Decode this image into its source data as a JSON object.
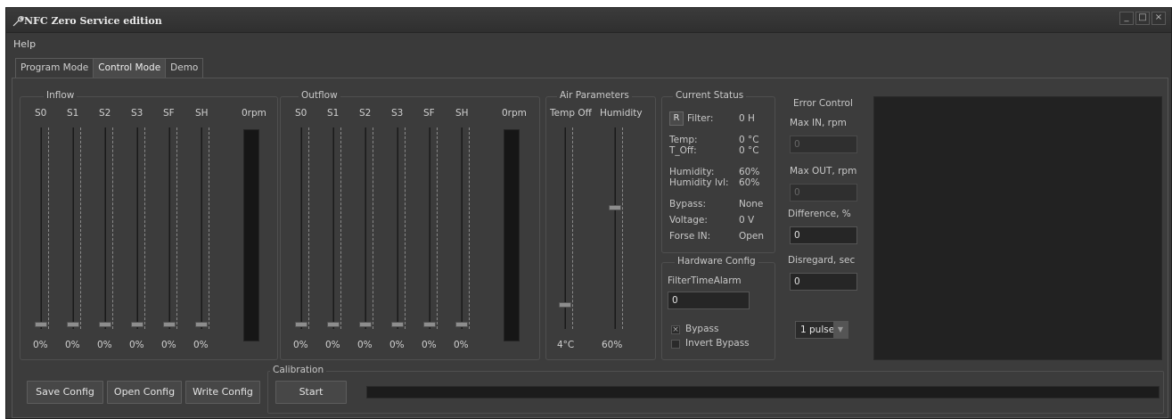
{
  "window": {
    "title": "NFC Zero Service edition",
    "controls": [
      "_",
      "□",
      "×"
    ]
  },
  "menu": {
    "help": "Help"
  },
  "tabs": [
    {
      "label": "Program Mode",
      "active": false
    },
    {
      "label": "Control Mode",
      "active": true
    },
    {
      "label": "Demo",
      "active": false
    }
  ],
  "inflow": {
    "title": "Inflow",
    "columns": [
      "S0",
      "S1",
      "S2",
      "S3",
      "SF",
      "SH"
    ],
    "values": [
      "0%",
      "0%",
      "0%",
      "0%",
      "0%",
      "0%"
    ],
    "slider_levels": [
      0,
      0,
      0,
      0,
      0,
      0
    ],
    "rpm_label": "0rpm"
  },
  "outflow": {
    "title": "Outflow",
    "columns": [
      "S0",
      "S1",
      "S2",
      "S3",
      "SF",
      "SH"
    ],
    "values": [
      "0%",
      "0%",
      "0%",
      "0%",
      "0%",
      "0%"
    ],
    "slider_levels": [
      0,
      0,
      0,
      0,
      0,
      0
    ],
    "rpm_label": "0rpm"
  },
  "air": {
    "title": "Air Parameters",
    "temp_label": "Temp Off",
    "humidity_label": "Humidity",
    "temp_value": "4°C",
    "humidity_value": "60%",
    "temp_level": 0.1,
    "humidity_level": 0.6
  },
  "status": {
    "title": "Current Status",
    "reset_button": "R",
    "rows": [
      {
        "label": "Filter:",
        "value": "0 H"
      },
      {
        "label": "Temp:",
        "value": "0 °C"
      },
      {
        "label": "T_Off:",
        "value": "0 °C"
      },
      {
        "label": "Humidity:",
        "value": "60%"
      },
      {
        "label": "Humidity lvl:",
        "value": "60%"
      },
      {
        "label": "Bypass:",
        "value": "None"
      },
      {
        "label": "Voltage:",
        "value": "0 V"
      },
      {
        "label": "Forse IN:",
        "value": "Open"
      }
    ]
  },
  "hardware": {
    "title": "Hardware Config",
    "filter_label": "FilterTimeAlarm",
    "filter_value": "0",
    "bypass_label": "Bypass",
    "bypass_checked": true,
    "invert_label": "Invert Bypass",
    "invert_checked": false
  },
  "error": {
    "title": "Error Control",
    "max_in_label": "Max IN, rpm",
    "max_in_value": "0",
    "max_out_label": "Max OUT, rpm",
    "max_out_value": "0",
    "diff_label": "Difference, %",
    "diff_value": "0",
    "disregard_label": "Disregard, sec",
    "disregard_value": "0",
    "pulse_value": "1 pulse"
  },
  "buttons": {
    "save": "Save Config",
    "open": "Open Config",
    "write": "Write Config"
  },
  "calibration": {
    "title": "Calibration",
    "start": "Start",
    "progress": 0
  }
}
